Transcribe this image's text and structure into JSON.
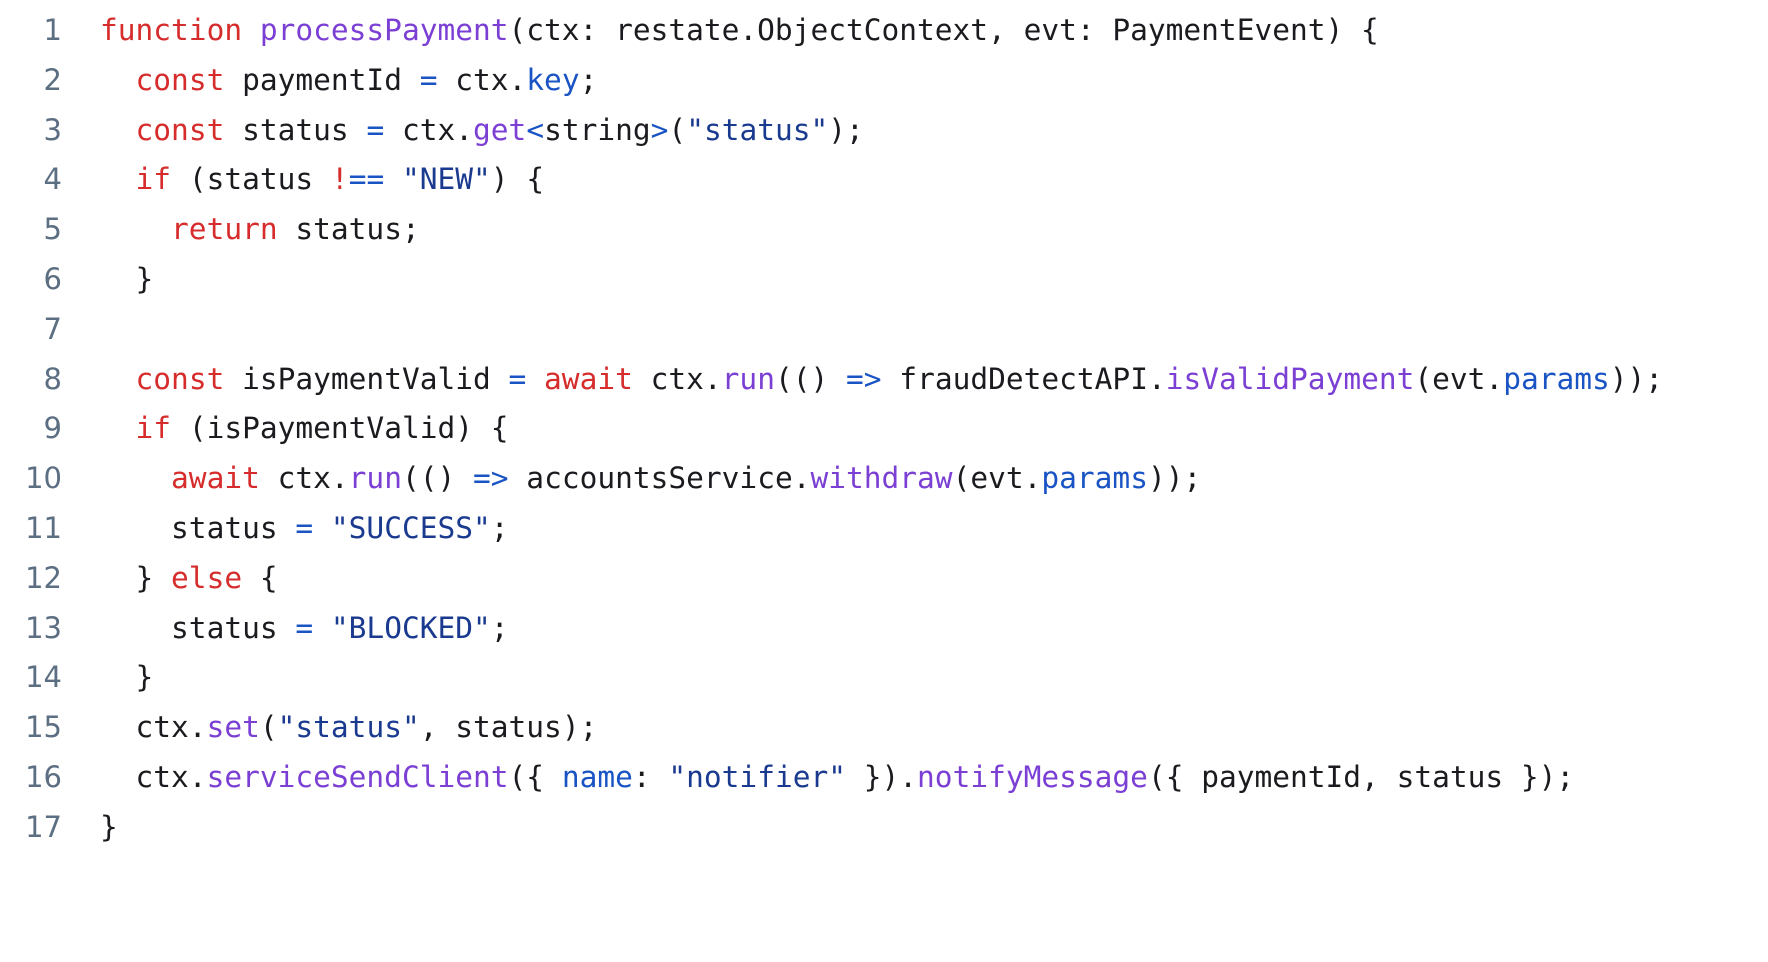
{
  "editor": {
    "language": "typescript",
    "background": "#ffffff",
    "line_number_color": "#5c6f82",
    "plain_text_color": "#1b1b1f",
    "keyword_color": "#d62c2c",
    "function_color": "#7b3fd4",
    "property_color": "#1a54c4",
    "string_color": "#1a3a8f",
    "operator_color": "#1a54c4",
    "total_lines": 17
  },
  "lines": [
    {
      "number": "1",
      "text": "function processPayment(ctx: restate.ObjectContext, evt: PaymentEvent) {",
      "tokens": [
        {
          "t": "function",
          "c": "t-kw"
        },
        {
          "t": " ",
          "c": "t-pln"
        },
        {
          "t": "processPayment",
          "c": "t-fn"
        },
        {
          "t": "(ctx: restate.ObjectContext, evt: PaymentEvent) {",
          "c": "t-pln"
        }
      ]
    },
    {
      "number": "2",
      "text": "  const paymentId = ctx.key;",
      "tokens": [
        {
          "t": "  ",
          "c": "t-pln"
        },
        {
          "t": "const",
          "c": "t-kw"
        },
        {
          "t": " paymentId ",
          "c": "t-pln"
        },
        {
          "t": "=",
          "c": "t-op"
        },
        {
          "t": " ctx.",
          "c": "t-pln"
        },
        {
          "t": "key",
          "c": "t-prop"
        },
        {
          "t": ";",
          "c": "t-pln"
        }
      ]
    },
    {
      "number": "3",
      "text": "  const status = ctx.get<string>(\"status\");",
      "tokens": [
        {
          "t": "  ",
          "c": "t-pln"
        },
        {
          "t": "const",
          "c": "t-kw"
        },
        {
          "t": " status ",
          "c": "t-pln"
        },
        {
          "t": "=",
          "c": "t-op"
        },
        {
          "t": " ctx.",
          "c": "t-pln"
        },
        {
          "t": "get",
          "c": "t-fn"
        },
        {
          "t": "<",
          "c": "t-op"
        },
        {
          "t": "string",
          "c": "t-pln"
        },
        {
          "t": ">",
          "c": "t-op"
        },
        {
          "t": "(",
          "c": "t-pln"
        },
        {
          "t": "\"status\"",
          "c": "t-str"
        },
        {
          "t": ");",
          "c": "t-pln"
        }
      ]
    },
    {
      "number": "4",
      "text": "  if (status !== \"NEW\") {",
      "tokens": [
        {
          "t": "  ",
          "c": "t-pln"
        },
        {
          "t": "if",
          "c": "t-kw"
        },
        {
          "t": " (status ",
          "c": "t-pln"
        },
        {
          "t": "!",
          "c": "t-kw"
        },
        {
          "t": "==",
          "c": "t-op"
        },
        {
          "t": " ",
          "c": "t-pln"
        },
        {
          "t": "\"NEW\"",
          "c": "t-str"
        },
        {
          "t": ") {",
          "c": "t-pln"
        }
      ]
    },
    {
      "number": "5",
      "text": "    return status;",
      "tokens": [
        {
          "t": "    ",
          "c": "t-pln"
        },
        {
          "t": "return",
          "c": "t-kw"
        },
        {
          "t": " status;",
          "c": "t-pln"
        }
      ]
    },
    {
      "number": "6",
      "text": "  }",
      "tokens": [
        {
          "t": "  }",
          "c": "t-pln"
        }
      ]
    },
    {
      "number": "7",
      "text": "",
      "tokens": []
    },
    {
      "number": "8",
      "text": "  const isPaymentValid = await ctx.run(() => fraudDetectAPI.isValidPayment(evt.params));",
      "tokens": [
        {
          "t": "  ",
          "c": "t-pln"
        },
        {
          "t": "const",
          "c": "t-kw"
        },
        {
          "t": " isPaymentValid ",
          "c": "t-pln"
        },
        {
          "t": "=",
          "c": "t-op"
        },
        {
          "t": " ",
          "c": "t-pln"
        },
        {
          "t": "await",
          "c": "t-kw"
        },
        {
          "t": " ctx.",
          "c": "t-pln"
        },
        {
          "t": "run",
          "c": "t-fn"
        },
        {
          "t": "(() ",
          "c": "t-pln"
        },
        {
          "t": "=>",
          "c": "t-op"
        },
        {
          "t": " fraudDetectAPI.",
          "c": "t-pln"
        },
        {
          "t": "isValidPayment",
          "c": "t-fn"
        },
        {
          "t": "(evt.",
          "c": "t-pln"
        },
        {
          "t": "params",
          "c": "t-prop"
        },
        {
          "t": "));",
          "c": "t-pln"
        }
      ]
    },
    {
      "number": "9",
      "text": "  if (isPaymentValid) {",
      "tokens": [
        {
          "t": "  ",
          "c": "t-pln"
        },
        {
          "t": "if",
          "c": "t-kw"
        },
        {
          "t": " (isPaymentValid) {",
          "c": "t-pln"
        }
      ]
    },
    {
      "number": "10",
      "text": "    await ctx.run(() => accountsService.withdraw(evt.params));",
      "tokens": [
        {
          "t": "    ",
          "c": "t-pln"
        },
        {
          "t": "await",
          "c": "t-kw"
        },
        {
          "t": " ctx.",
          "c": "t-pln"
        },
        {
          "t": "run",
          "c": "t-fn"
        },
        {
          "t": "(() ",
          "c": "t-pln"
        },
        {
          "t": "=>",
          "c": "t-op"
        },
        {
          "t": " accountsService.",
          "c": "t-pln"
        },
        {
          "t": "withdraw",
          "c": "t-fn"
        },
        {
          "t": "(evt.",
          "c": "t-pln"
        },
        {
          "t": "params",
          "c": "t-prop"
        },
        {
          "t": "));",
          "c": "t-pln"
        }
      ]
    },
    {
      "number": "11",
      "text": "    status = \"SUCCESS\";",
      "tokens": [
        {
          "t": "    status ",
          "c": "t-pln"
        },
        {
          "t": "=",
          "c": "t-op"
        },
        {
          "t": " ",
          "c": "t-pln"
        },
        {
          "t": "\"SUCCESS\"",
          "c": "t-str"
        },
        {
          "t": ";",
          "c": "t-pln"
        }
      ]
    },
    {
      "number": "12",
      "text": "  } else {",
      "tokens": [
        {
          "t": "  } ",
          "c": "t-pln"
        },
        {
          "t": "else",
          "c": "t-kw"
        },
        {
          "t": " {",
          "c": "t-pln"
        }
      ]
    },
    {
      "number": "13",
      "text": "    status = \"BLOCKED\";",
      "tokens": [
        {
          "t": "    status ",
          "c": "t-pln"
        },
        {
          "t": "=",
          "c": "t-op"
        },
        {
          "t": " ",
          "c": "t-pln"
        },
        {
          "t": "\"BLOCKED\"",
          "c": "t-str"
        },
        {
          "t": ";",
          "c": "t-pln"
        }
      ]
    },
    {
      "number": "14",
      "text": "  }",
      "tokens": [
        {
          "t": "  }",
          "c": "t-pln"
        }
      ]
    },
    {
      "number": "15",
      "text": "  ctx.set(\"status\", status);",
      "tokens": [
        {
          "t": "  ctx.",
          "c": "t-pln"
        },
        {
          "t": "set",
          "c": "t-fn"
        },
        {
          "t": "(",
          "c": "t-pln"
        },
        {
          "t": "\"status\"",
          "c": "t-str"
        },
        {
          "t": ", status);",
          "c": "t-pln"
        }
      ]
    },
    {
      "number": "16",
      "text": "  ctx.serviceSendClient({ name: \"notifier\" }).notifyMessage({ paymentId, status });",
      "tokens": [
        {
          "t": "  ctx.",
          "c": "t-pln"
        },
        {
          "t": "serviceSendClient",
          "c": "t-fn"
        },
        {
          "t": "({ ",
          "c": "t-pln"
        },
        {
          "t": "name",
          "c": "t-prop"
        },
        {
          "t": ": ",
          "c": "t-pln"
        },
        {
          "t": "\"notifier\"",
          "c": "t-str"
        },
        {
          "t": " }).",
          "c": "t-pln"
        },
        {
          "t": "notifyMessage",
          "c": "t-fn"
        },
        {
          "t": "({ paymentId, status });",
          "c": "t-pln"
        }
      ]
    },
    {
      "number": "17",
      "text": "}",
      "tokens": [
        {
          "t": "}",
          "c": "t-pln"
        }
      ]
    }
  ]
}
